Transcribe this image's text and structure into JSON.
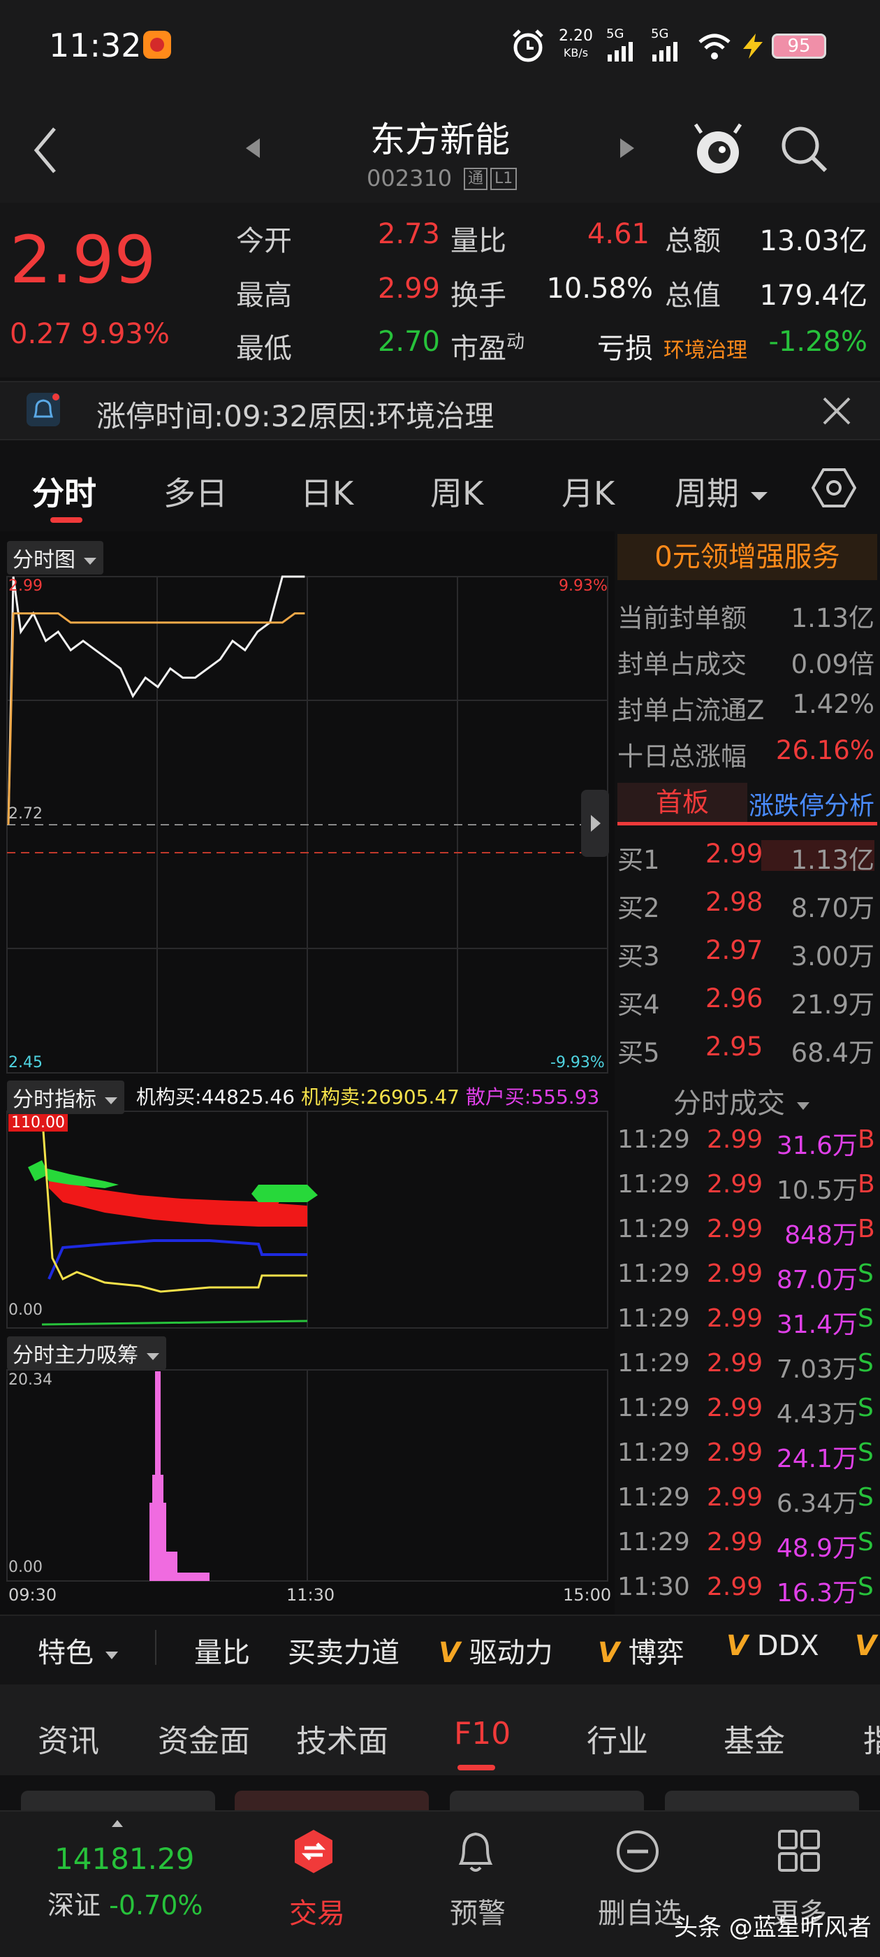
{
  "status": {
    "time": "11:32",
    "net_speed": "2.20",
    "net_unit": "KB/s",
    "net1": "5G",
    "net2": "5G",
    "battery": "95"
  },
  "header": {
    "name": "东方新能",
    "code": "002310",
    "tag1": "通",
    "tag2": "L1"
  },
  "quote": {
    "price": "2.99",
    "change": "0.27",
    "change_pct": "9.93%",
    "rows": [
      {
        "l1": "今开",
        "v1": "2.73",
        "l2": "量比",
        "v2": "4.61",
        "l3": "总额",
        "v3": "13.03亿"
      },
      {
        "l1": "最高",
        "v1": "2.99",
        "l2": "换手",
        "v2": "10.58%",
        "l3": "总值",
        "v3": "179.4亿"
      },
      {
        "l1": "最低",
        "v1": "2.70",
        "l2": "市盈",
        "l2sup": "动",
        "v2": "亏损",
        "l3": "环境治理",
        "v3": "-1.28%"
      }
    ]
  },
  "notice": {
    "text": "涨停时间:09:32原因:环境治理"
  },
  "tabs": [
    "分时",
    "多日",
    "日K",
    "周K",
    "月K",
    "周期"
  ],
  "chart": {
    "main_label": "分时图",
    "price_high": "2.99",
    "pct_high": "9.93%",
    "price_mid": "2.72",
    "price_low": "2.45",
    "pct_low": "-9.93%",
    "indicator_label": "分时指标",
    "indicator_values": [
      {
        "text": "机构买:44825.46",
        "color": "#f2f2f2"
      },
      {
        "text": "机构卖:26905.47",
        "color": "#f5e14a"
      },
      {
        "text": "散户买:555.93",
        "color": "#e040e8"
      }
    ],
    "indicator_max": "110.00",
    "indicator_min": "0.00",
    "flow_label": "分时主力吸筹",
    "flow_max": "20.34",
    "flow_min": "0.00",
    "time_start": "09:30",
    "time_mid": "11:30",
    "time_end": "15:00"
  },
  "chart_data": {
    "type": "line",
    "title": "分时图",
    "x": [
      "09:30",
      "09:32",
      "09:35",
      "09:40",
      "09:45",
      "09:50",
      "09:55",
      "10:00",
      "10:05",
      "10:10",
      "10:15",
      "10:20",
      "10:25",
      "10:30",
      "10:35",
      "10:40",
      "10:45",
      "10:50",
      "10:55",
      "11:00",
      "11:05",
      "11:10",
      "11:15",
      "11:20",
      "11:25",
      "11:29"
    ],
    "series": [
      {
        "name": "price",
        "values": [
          2.72,
          2.99,
          2.93,
          2.95,
          2.92,
          2.93,
          2.91,
          2.92,
          2.91,
          2.9,
          2.89,
          2.86,
          2.88,
          2.87,
          2.89,
          2.88,
          2.88,
          2.89,
          2.9,
          2.92,
          2.91,
          2.93,
          2.94,
          2.99,
          2.99,
          2.99
        ]
      },
      {
        "name": "avg",
        "values": [
          2.72,
          2.95,
          2.95,
          2.95,
          2.95,
          2.95,
          2.94,
          2.94,
          2.94,
          2.94,
          2.94,
          2.94,
          2.94,
          2.94,
          2.94,
          2.94,
          2.94,
          2.94,
          2.94,
          2.94,
          2.94,
          2.94,
          2.94,
          2.94,
          2.95,
          2.95
        ]
      }
    ],
    "ylim": [
      2.45,
      2.99
    ]
  },
  "right_panel": {
    "promo": "0元领增强服务",
    "stats": [
      {
        "label": "当前封单额",
        "value": "1.13亿",
        "color": "#9a9a9a"
      },
      {
        "label": "封单占成交",
        "value": "0.09倍",
        "color": "#9a9a9a"
      },
      {
        "label": "封单占流通Z",
        "value": "1.42%",
        "color": "#9a9a9a"
      },
      {
        "label": "十日总涨幅",
        "value": "26.16%",
        "color": "#f03a3a"
      }
    ],
    "board_tab": "首板",
    "analysis_tab": "涨跌停分析",
    "bids": [
      {
        "label": "买1",
        "price": "2.99",
        "vol": "1.13亿"
      },
      {
        "label": "买2",
        "price": "2.98",
        "vol": "8.70万"
      },
      {
        "label": "买3",
        "price": "2.97",
        "vol": "3.00万"
      },
      {
        "label": "买4",
        "price": "2.96",
        "vol": "21.9万"
      },
      {
        "label": "买5",
        "price": "2.95",
        "vol": "68.4万"
      }
    ],
    "trades_title": "分时成交",
    "trades": [
      {
        "t": "11:29",
        "p": "2.99",
        "v": "31.6万",
        "s": "B",
        "vc": "#e040e8",
        "sc": "#f03a3a"
      },
      {
        "t": "11:29",
        "p": "2.99",
        "v": "10.5万",
        "s": "B",
        "vc": "#9a9a9a",
        "sc": "#f03a3a"
      },
      {
        "t": "11:29",
        "p": "2.99",
        "v": "848万",
        "s": "B",
        "vc": "#e040e8",
        "sc": "#f03a3a"
      },
      {
        "t": "11:29",
        "p": "2.99",
        "v": "87.0万",
        "s": "S",
        "vc": "#e040e8",
        "sc": "#27c23b"
      },
      {
        "t": "11:29",
        "p": "2.99",
        "v": "31.4万",
        "s": "S",
        "vc": "#e040e8",
        "sc": "#27c23b"
      },
      {
        "t": "11:29",
        "p": "2.99",
        "v": "7.03万",
        "s": "S",
        "vc": "#9a9a9a",
        "sc": "#27c23b"
      },
      {
        "t": "11:29",
        "p": "2.99",
        "v": "4.43万",
        "s": "S",
        "vc": "#9a9a9a",
        "sc": "#27c23b"
      },
      {
        "t": "11:29",
        "p": "2.99",
        "v": "24.1万",
        "s": "S",
        "vc": "#e040e8",
        "sc": "#27c23b"
      },
      {
        "t": "11:29",
        "p": "2.99",
        "v": "6.34万",
        "s": "S",
        "vc": "#9a9a9a",
        "sc": "#27c23b"
      },
      {
        "t": "11:29",
        "p": "2.99",
        "v": "48.9万",
        "s": "S",
        "vc": "#e040e8",
        "sc": "#27c23b"
      },
      {
        "t": "11:30",
        "p": "2.99",
        "v": "16.3万",
        "s": "S",
        "vc": "#e040e8",
        "sc": "#27c23b"
      }
    ]
  },
  "features": {
    "special": "特色",
    "items": [
      "量比",
      "买卖力道",
      "驱动力",
      "博弈",
      "DDX"
    ]
  },
  "info_tabs": [
    "资讯",
    "资金面",
    "技术面",
    "F10",
    "行业",
    "基金",
    "指"
  ],
  "bottom_nav": {
    "index_value": "14181.29",
    "index_label": "深证",
    "index_change": "-0.70%",
    "trade": "交易",
    "alert": "预警",
    "remove": "删自选",
    "more": "更多"
  },
  "watermark": "头条 @蓝星听风者"
}
